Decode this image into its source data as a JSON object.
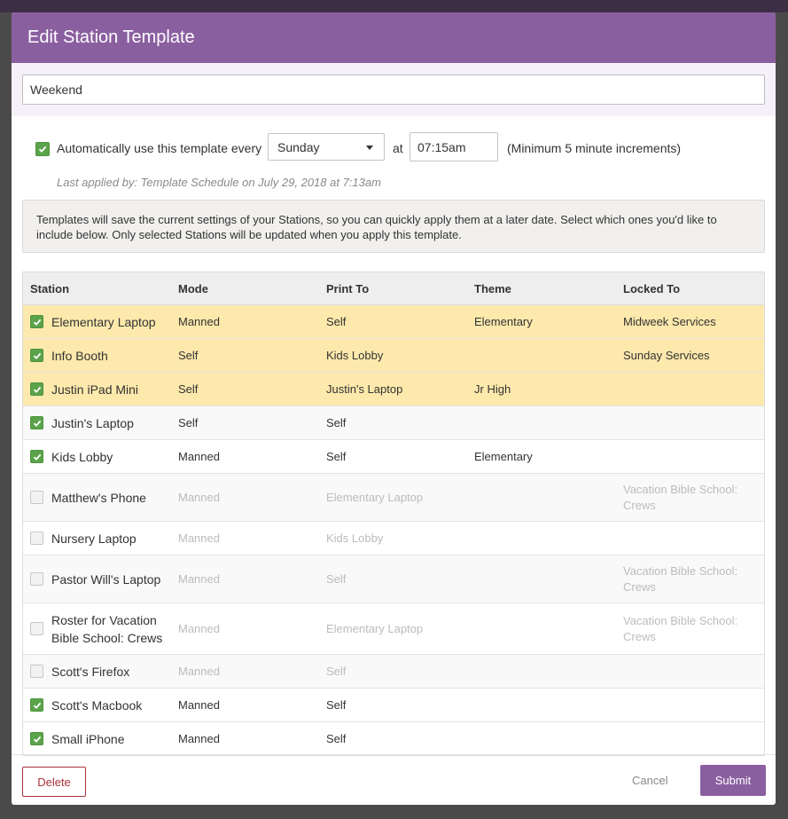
{
  "modal": {
    "title": "Edit Station Template",
    "name_value": "Weekend"
  },
  "schedule": {
    "auto_checked": true,
    "auto_label": "Automatically use this template every",
    "day_value": "Sunday",
    "at_label": "at",
    "time_value": "07:15am",
    "increment_note": "(Minimum 5 minute increments)",
    "last_applied": "Last applied by: Template Schedule on July 29, 2018 at 7:13am"
  },
  "info_text": "Templates will save the current settings of your Stations, so you can quickly apply them at a later date. Select which ones you'd like to include below. Only selected Stations will be updated when you apply this template.",
  "table": {
    "headers": [
      "Station",
      "Mode",
      "Print To",
      "Theme",
      "Locked To"
    ],
    "rows": [
      {
        "checked": true,
        "highlight": true,
        "station": "Elementary Laptop",
        "mode": "Manned",
        "print_to": "Self",
        "theme": "Elementary",
        "locked_to": "Midweek Services"
      },
      {
        "checked": true,
        "highlight": true,
        "station": "Info Booth",
        "mode": "Self",
        "print_to": "Kids Lobby",
        "theme": "",
        "locked_to": "Sunday Services"
      },
      {
        "checked": true,
        "highlight": true,
        "station": "Justin iPad Mini",
        "mode": "Self",
        "print_to": "Justin's Laptop",
        "theme": "Jr High",
        "locked_to": ""
      },
      {
        "checked": true,
        "highlight": false,
        "station": "Justin's Laptop",
        "mode": "Self",
        "print_to": "Self",
        "theme": "",
        "locked_to": ""
      },
      {
        "checked": true,
        "highlight": false,
        "station": "Kids Lobby",
        "mode": "Manned",
        "print_to": "Self",
        "theme": "Elementary",
        "locked_to": ""
      },
      {
        "checked": false,
        "highlight": false,
        "station": "Matthew's Phone",
        "mode": "Manned",
        "print_to": "Elementary Laptop",
        "theme": "",
        "locked_to": "Vacation Bible School: Crews"
      },
      {
        "checked": false,
        "highlight": false,
        "station": "Nursery Laptop",
        "mode": "Manned",
        "print_to": "Kids Lobby",
        "theme": "",
        "locked_to": ""
      },
      {
        "checked": false,
        "highlight": false,
        "station": "Pastor Will's Laptop",
        "mode": "Manned",
        "print_to": "Self",
        "theme": "",
        "locked_to": "Vacation Bible School: Crews"
      },
      {
        "checked": false,
        "highlight": false,
        "station": "Roster for Vacation Bible School: Crews",
        "mode": "Manned",
        "print_to": "Elementary Laptop",
        "theme": "",
        "locked_to": "Vacation Bible School: Crews"
      },
      {
        "checked": false,
        "highlight": false,
        "station": "Scott's Firefox",
        "mode": "Manned",
        "print_to": "Self",
        "theme": "",
        "locked_to": ""
      },
      {
        "checked": true,
        "highlight": false,
        "station": "Scott's Macbook",
        "mode": "Manned",
        "print_to": "Self",
        "theme": "",
        "locked_to": ""
      },
      {
        "checked": true,
        "highlight": false,
        "station": "Small iPhone",
        "mode": "Manned",
        "print_to": "Self",
        "theme": "",
        "locked_to": ""
      }
    ]
  },
  "footer": {
    "delete_label": "Delete",
    "cancel_label": "Cancel",
    "submit_label": "Submit"
  },
  "colors": {
    "header_purple": "#8a5fa0",
    "check_green": "#5ba34b",
    "highlight_yellow": "#fde9ac",
    "delete_red": "#a8343a"
  }
}
